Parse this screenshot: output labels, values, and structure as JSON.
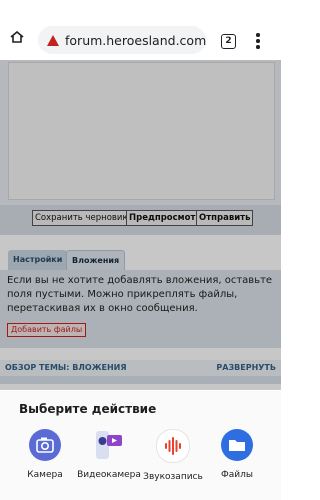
{
  "browser": {
    "url": "forum.heroesland.com/",
    "tab_count": "2"
  },
  "editor": {
    "buttons": [
      "Сохранить черновик",
      "Предпросмотр",
      "Отправить"
    ]
  },
  "tabs": [
    "Настройки",
    "Вложения"
  ],
  "attachments": {
    "info": "Если вы не хотите добавлять вложения, оставьте поля пустыми. Можно прикреплять файлы, перетаскивая их в окно сообщения.",
    "add_files": "Добавить файлы"
  },
  "overview": {
    "title": "ОБЗОР ТЕМЫ: ВЛОЖЕНИЯ",
    "expand": "РАЗВЕРНУТЬ"
  },
  "sheet": {
    "title": "Выберите действие",
    "apps": [
      {
        "label": "Камера",
        "icon": "camera-icon"
      },
      {
        "label": "Видеокамера",
        "icon": "video-camera-icon"
      },
      {
        "label": "Звукозапись",
        "icon": "sound-recorder-icon"
      },
      {
        "label": "Файлы",
        "icon": "folder-icon"
      }
    ]
  },
  "colors": {
    "warning": "#c5221f",
    "link": "#35618a",
    "camera": "#5b6bd6",
    "files": "#2e6ee0",
    "recorder": "#e8412c"
  }
}
